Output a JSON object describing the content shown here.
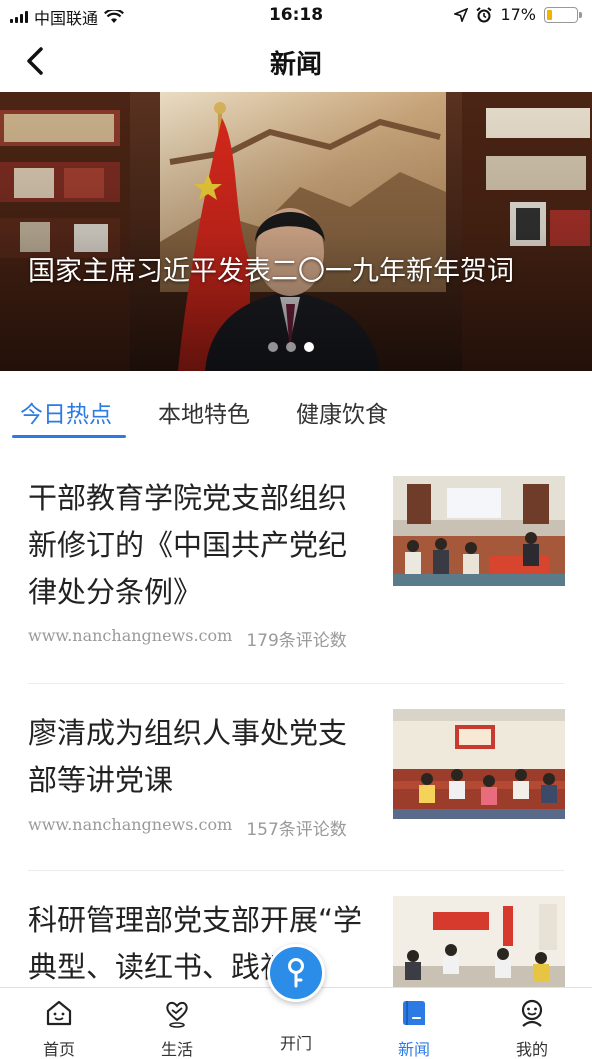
{
  "status_bar": {
    "carrier": "中国联通",
    "time": "16:18",
    "battery_text": "17%",
    "battery_level": 0.17,
    "icons": [
      "signal-icon",
      "wifi-icon",
      "location-icon",
      "alarm-icon",
      "battery-icon"
    ]
  },
  "nav": {
    "title": "新闻",
    "back_icon": "chevron-left-icon"
  },
  "banner": {
    "caption": "国家主席习近平发表二〇一九年新年贺词",
    "slide_count": 3,
    "active_slide": 3
  },
  "tabs": [
    {
      "label": "今日热点",
      "active": true
    },
    {
      "label": "本地特色",
      "active": false
    },
    {
      "label": "健康饮食",
      "active": false
    }
  ],
  "news": [
    {
      "title": "干部教育学院党支部组织新修订的《中国共产党纪律处分条例》",
      "source": "www.nanchangnews.com",
      "comments": "179条评论数"
    },
    {
      "title": "廖清成为组织人事处党支部等讲党课",
      "source": "www.nanchangnews.com",
      "comments": "157条评论数"
    },
    {
      "title": "科研管理部党支部开展“学典型、读红书、践初",
      "source": "",
      "comments": ""
    }
  ],
  "tab_bar": {
    "items": [
      {
        "label": "首页",
        "icon": "home-icon"
      },
      {
        "label": "生活",
        "icon": "heart-location-icon"
      },
      {
        "label": "开门",
        "icon": "key-icon"
      },
      {
        "label": "新闻",
        "icon": "news-icon",
        "active": true
      },
      {
        "label": "我的",
        "icon": "profile-icon"
      }
    ],
    "accent_color": "#2c7be5"
  }
}
